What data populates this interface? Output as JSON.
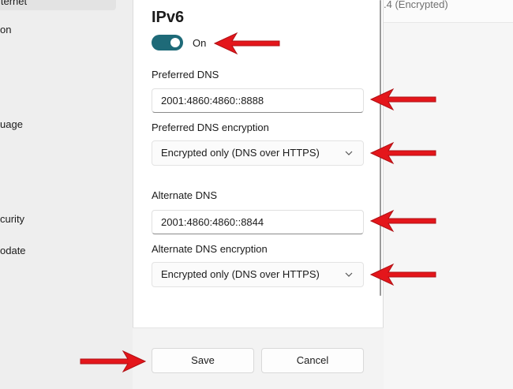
{
  "background": {
    "sidebar_items": [
      "iternet",
      "on",
      "uage",
      "curity",
      "odate"
    ],
    "dns_status": ".4 (Encrypted)"
  },
  "dialog": {
    "title": "IPv6",
    "ipv6_toggle": {
      "state": "on",
      "label": "On"
    },
    "preferred_dns": {
      "label": "Preferred DNS",
      "value": "2001:4860:4860::8888"
    },
    "preferred_dns_encryption": {
      "label": "Preferred DNS encryption",
      "selected": "Encrypted only (DNS over HTTPS)"
    },
    "alternate_dns": {
      "label": "Alternate DNS",
      "value": "2001:4860:4860::8844"
    },
    "alternate_dns_encryption": {
      "label": "Alternate DNS encryption",
      "selected": "Encrypted only (DNS over HTTPS)"
    },
    "save_label": "Save",
    "cancel_label": "Cancel"
  },
  "colors": {
    "accent": "#1e6a78",
    "annotation_arrow": "#e4161b"
  },
  "icons": [
    "chevron-down-icon",
    "annotation-arrow"
  ]
}
